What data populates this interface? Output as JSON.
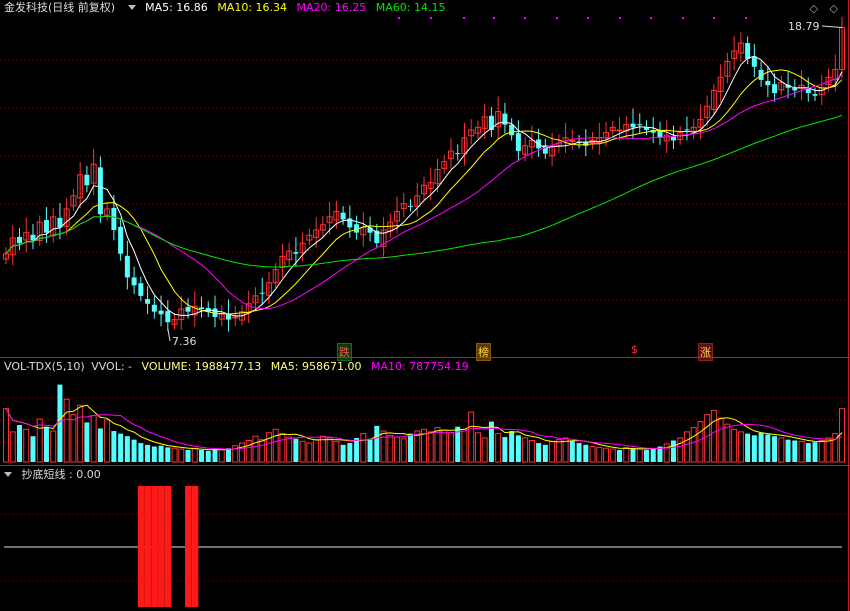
{
  "main_header": {
    "title": "金发科技(日线 前复权)",
    "ma5": "MA5: 16.86",
    "ma10": "MA10: 16.34",
    "ma20": "MA20: 16.25",
    "ma60": "MA60: 14.15"
  },
  "price_labels": {
    "high": "18.79",
    "low": "7.36"
  },
  "markers": {
    "die": "跌",
    "bang": "榜",
    "dollar": "$",
    "zhang": "涨"
  },
  "volume_header": {
    "indicator": "VOL-TDX(5,10)",
    "vvol": "VVOL: -",
    "volume": "VOLUME: 1988477.13",
    "ma5": "MA5: 958671.00",
    "ma10": "MA10: 787754.19"
  },
  "bottom_header": {
    "indicator": "抄底短线 : 0.00"
  },
  "window_controls": "◇ ◇",
  "colors": {
    "up": "#ff3232",
    "down": "#54ffff",
    "ma5": "#ffffff",
    "ma10": "#ffff00",
    "ma20": "#ff00ff",
    "ma60": "#00e600",
    "grid": "#8b0000"
  },
  "chart_data": [
    {
      "type": "candlestick",
      "title": "金发科技(日线 前复权)",
      "yrange": [
        7.36,
        18.79
      ],
      "annotated_high": 18.79,
      "annotated_low": 7.36,
      "closes": [
        10.2,
        10.8,
        10.6,
        11.0,
        10.7,
        11.4,
        11.0,
        11.6,
        11.2,
        11.9,
        12.4,
        13.2,
        12.8,
        13.6,
        11.7,
        11.9,
        11.1,
        10.2,
        9.3,
        9.0,
        8.6,
        8.3,
        8.0,
        7.9,
        7.6,
        7.7,
        8.1,
        8.0,
        8.2,
        8.1,
        8.0,
        7.8,
        7.9,
        7.7,
        7.8,
        8.0,
        8.3,
        8.6,
        8.7,
        9.1,
        9.6,
        10.1,
        10.3,
        10.2,
        10.6,
        10.9,
        11.1,
        11.3,
        11.6,
        11.8,
        11.5,
        11.2,
        11.0,
        11.2,
        11.0,
        10.6,
        11.1,
        11.4,
        11.8,
        12.1,
        12.0,
        12.4,
        12.8,
        12.9,
        13.4,
        13.7,
        14.1,
        14.0,
        14.6,
        14.9,
        15.0,
        15.4,
        14.9,
        15.6,
        15.1,
        14.7,
        14.1,
        14.3,
        14.5,
        14.2,
        14.0,
        14.3,
        14.4,
        14.6,
        14.5,
        14.4,
        14.3,
        14.5,
        14.6,
        14.8,
        15.0,
        14.9,
        15.1,
        15.0,
        15.1,
        14.9,
        14.8,
        14.6,
        14.7,
        14.5,
        14.8,
        14.9,
        15.0,
        15.3,
        15.8,
        16.4,
        16.9,
        17.5,
        17.9,
        18.2,
        17.6,
        17.3,
        16.8,
        16.6,
        16.3,
        16.7,
        16.5,
        16.4,
        16.6,
        16.3,
        16.2,
        16.5,
        16.9,
        17.2,
        18.79
      ]
    },
    {
      "type": "bar",
      "title": "VOL-TDX(5,10)",
      "series": [
        {
          "name": "VOLUME",
          "last": 1988477.13
        },
        {
          "name": "MA5",
          "last": 958671.0
        },
        {
          "name": "MA10",
          "last": 787754.19
        }
      ],
      "values": [
        0.62,
        0.35,
        0.43,
        0.38,
        0.3,
        0.5,
        0.41,
        0.36,
        0.9,
        0.73,
        0.55,
        0.66,
        0.46,
        0.54,
        0.39,
        0.49,
        0.36,
        0.33,
        0.3,
        0.26,
        0.22,
        0.2,
        0.18,
        0.19,
        0.17,
        0.16,
        0.15,
        0.14,
        0.16,
        0.14,
        0.13,
        0.15,
        0.14,
        0.16,
        0.19,
        0.22,
        0.25,
        0.3,
        0.26,
        0.34,
        0.38,
        0.33,
        0.29,
        0.27,
        0.24,
        0.22,
        0.26,
        0.3,
        0.28,
        0.24,
        0.2,
        0.22,
        0.28,
        0.33,
        0.27,
        0.42,
        0.36,
        0.31,
        0.29,
        0.27,
        0.33,
        0.36,
        0.38,
        0.35,
        0.4,
        0.37,
        0.34,
        0.41,
        0.38,
        0.58,
        0.34,
        0.28,
        0.47,
        0.33,
        0.29,
        0.36,
        0.31,
        0.28,
        0.25,
        0.22,
        0.2,
        0.24,
        0.26,
        0.28,
        0.25,
        0.22,
        0.2,
        0.18,
        0.17,
        0.16,
        0.15,
        0.14,
        0.17,
        0.16,
        0.15,
        0.14,
        0.16,
        0.18,
        0.21,
        0.25,
        0.28,
        0.35,
        0.4,
        0.47,
        0.55,
        0.6,
        0.51,
        0.44,
        0.38,
        0.35,
        0.33,
        0.31,
        0.34,
        0.32,
        0.3,
        0.28,
        0.26,
        0.25,
        0.24,
        0.22,
        0.23,
        0.25,
        0.28,
        0.33,
        0.62
      ]
    },
    {
      "type": "bar",
      "title": "抄底短线",
      "last": 0.0,
      "signal_indices": [
        20,
        21,
        22,
        23,
        24,
        27,
        28
      ]
    }
  ]
}
